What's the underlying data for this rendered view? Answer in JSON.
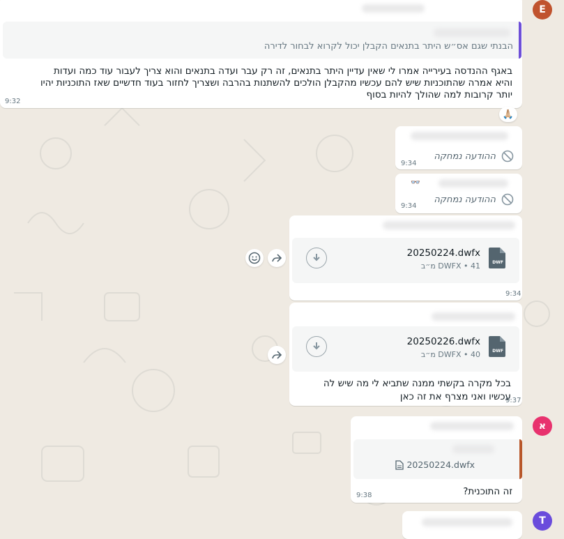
{
  "colors": {
    "chat_bg": "#efeae2",
    "bubble_bg": "#ffffff",
    "avatar_e": "#c0532e",
    "avatar_aleph": "#e8326e",
    "avatar_t": "#6a4cdc",
    "quote_bar_purple": "#6e4fd8",
    "quote_bar_brown": "#b8572a",
    "meta_text": "#667781"
  },
  "avatars": {
    "e": "E",
    "aleph": "א",
    "t": "T"
  },
  "messages": {
    "m1": {
      "quote_text": "הבנתי שגם אס״ש היתר בתנאים הקבלן יכול לקרוא לבחור לדירה",
      "line1": "באגף ההנדסה בעירייה אמרו לי שאין עדיין היתר בתנאים, זה רק עבר ועדה בתנאים והוא צריך לעבור עוד כמה ועדות",
      "line2": "והיא אמרה שהתוכניות שיש להם עכשיו מהקבלן הולכים להשתנות בהרבה ושצריך לחזור בעוד חדשיים שאז התוכניות יהיו",
      "line3": "יותר קרובות למה שהולך להיות בסוף",
      "time": "9:32",
      "reaction": "🙏🏼"
    },
    "m2": {
      "deleted_text": "ההודעה נמחקה",
      "time": "9:34"
    },
    "m3": {
      "sender_emoji": "👓",
      "deleted_text": "ההודעה נמחקה",
      "time": "9:34"
    },
    "m4": {
      "file_name": "20250224.dwfx",
      "file_meta": "DWFX • 41 מ״ב",
      "file_badge": "DWF",
      "time": "9:34"
    },
    "m5": {
      "file_name": "20250226.dwfx",
      "file_meta": "DWFX • 40 מ״ב",
      "file_badge": "DWF",
      "line1": "בכל מקרה בקשתי ממנה שתביא לי מה שיש לה",
      "line2": "עכשיו ואני מצרף את זה כאן",
      "time": "9:37"
    },
    "m6": {
      "quote_file": "20250224.dwfx",
      "text": "זה התוכנית?",
      "time": "9:38"
    }
  }
}
